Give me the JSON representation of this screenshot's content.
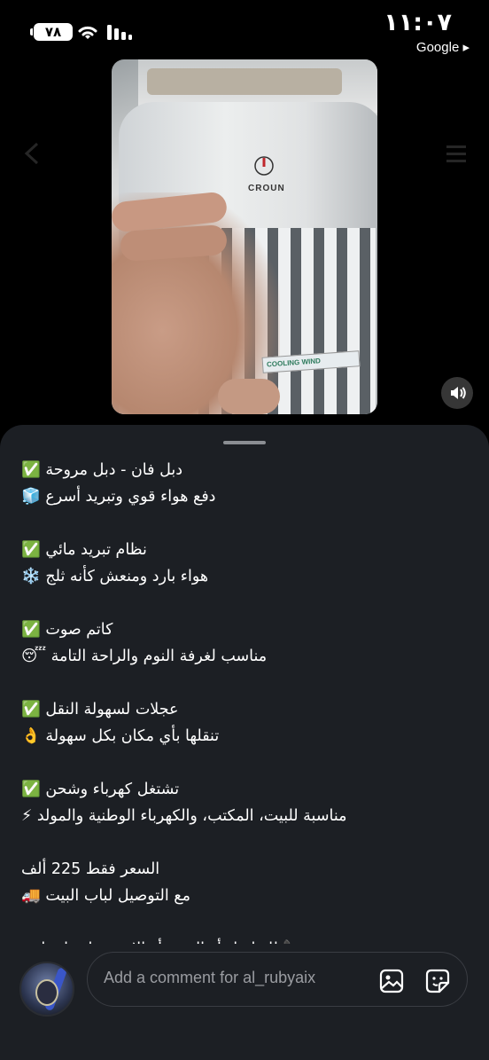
{
  "status_bar": {
    "time": "١١:٠٧",
    "battery": "٧٨",
    "back_app": "Google ▸"
  },
  "video": {
    "brand": "CROUN",
    "sticker": "COOLING WIND"
  },
  "caption": {
    "lines": [
      "دبل فان - دبل مروحة ✅",
      "دفع هواء قوي وتبريد أسرع 🧊",
      "",
      "نظام تبريد مائي ✅",
      "هواء بارد ومنعش كأنه ثلج ❄️",
      "",
      "كاتم صوت ✅",
      "مناسب لغرفة النوم والراحة التامة 😴",
      "",
      "عجلات لسهولة النقل ✅",
      "تنقلها بأي مكان بكل سهولة 👌",
      "",
      "تشتغل كهرباء وشحن ✅",
      "مناسبة للبيت، المكتب، والكهرباء الوطنية والمولد ⚡",
      "",
      "السعر فقط 225 ألف",
      "مع التوصيل لباب البيت 🚚",
      "",
      "📞 للتواصل أو الحجز أو الاستفسار واتساب:"
    ]
  },
  "composer": {
    "placeholder": "Add a comment for al_rubyaix"
  },
  "colors": {
    "background": "#000000",
    "sheet": "#1c1f24",
    "check_green": "#2fb344"
  }
}
